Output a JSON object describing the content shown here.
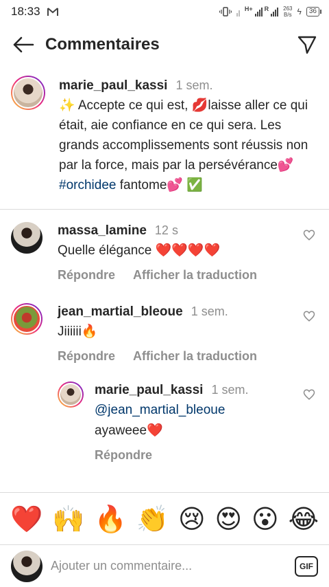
{
  "status_bar": {
    "time": "18:33",
    "mail_icon": "gmail-icon",
    "network": "H+",
    "network_r": "R",
    "speed_value": "263",
    "speed_unit": "B/s",
    "battery": "36"
  },
  "header": {
    "title": "Commentaires",
    "back_icon": "arrow-left-icon",
    "send_icon": "paper-plane-icon"
  },
  "caption": {
    "username": "marie_paul_kassi",
    "time": "1 sem.",
    "text_main": "✨ Accepte ce qui est, 💋laisse aller ce qui était, aie confiance en ce qui sera. Les grands accomplissements sont réussis non par la force, mais par la persévérance💕 ",
    "hashtag": "#orchidee",
    "text_end": " fantome💕 ✅"
  },
  "comments": [
    {
      "username": "massa_lamine",
      "time": "12 s",
      "text": "Quelle élégance ❤️❤️❤️❤️",
      "reply_label": "Répondre",
      "translate_label": "Afficher la traduction"
    },
    {
      "username": "jean_martial_bleoue",
      "time": "1 sem.",
      "text": "Jiiiiii🔥",
      "reply_label": "Répondre",
      "translate_label": "Afficher la traduction"
    }
  ],
  "reply": {
    "username": "marie_paul_kassi",
    "time": "1 sem.",
    "mention": "@jean_martial_bleoue",
    "text": "ayaweee❤️",
    "reply_label": "Répondre"
  },
  "reactions": [
    "❤️",
    "🙌",
    "🔥",
    "👏",
    "😢",
    "😍",
    "😮",
    "😂"
  ],
  "input": {
    "placeholder": "Ajouter un commentaire...",
    "gif_label": "GIF"
  },
  "colors": {
    "link": "#00376b",
    "muted": "#8e8e8e",
    "text": "#262626"
  }
}
